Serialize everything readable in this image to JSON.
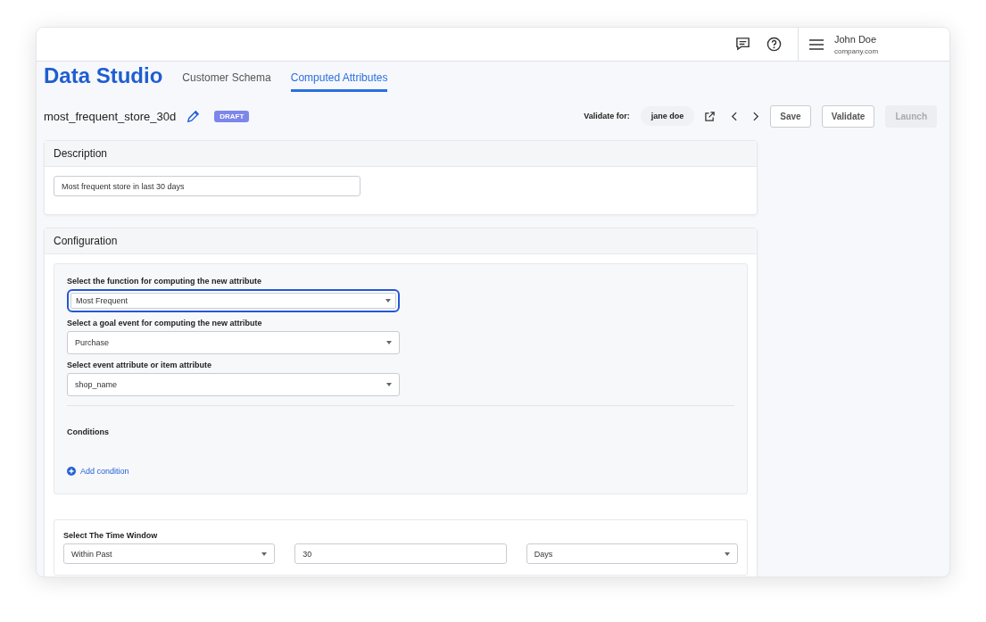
{
  "user": {
    "name": "John Doe",
    "company": "company.com"
  },
  "app_title": "Data Studio",
  "tabs": [
    {
      "label": "Customer Schema",
      "selected": false
    },
    {
      "label": "Computed Attributes",
      "selected": true
    }
  ],
  "attribute": {
    "name": "most_frequent_store_30d",
    "status": "DRAFT"
  },
  "validate": {
    "label": "Validate for:",
    "user": "jane doe"
  },
  "buttons": [
    {
      "label": "Save",
      "disabled": false
    },
    {
      "label": "Validate",
      "disabled": false
    },
    {
      "label": "Launch",
      "disabled": true
    }
  ],
  "description": {
    "title": "Description",
    "value": "Most frequent store in last 30 days"
  },
  "configuration": {
    "title": "Configuration",
    "fields": [
      {
        "label": "Select the function for computing the new attribute",
        "value": "Most Frequent",
        "focused": true
      },
      {
        "label": "Select a goal event for computing the new attribute",
        "value": "Purchase",
        "focused": false
      },
      {
        "label": "Select event attribute or item attribute",
        "value": "shop_name",
        "focused": false
      }
    ],
    "conditions_title": "Conditions",
    "add_condition": "Add condition"
  },
  "time_window": {
    "label": "Select The Time Window",
    "fields": [
      {
        "kind": "select",
        "value": "Within Past"
      },
      {
        "kind": "input",
        "value": "30"
      },
      {
        "kind": "select",
        "value": "Days"
      }
    ]
  }
}
